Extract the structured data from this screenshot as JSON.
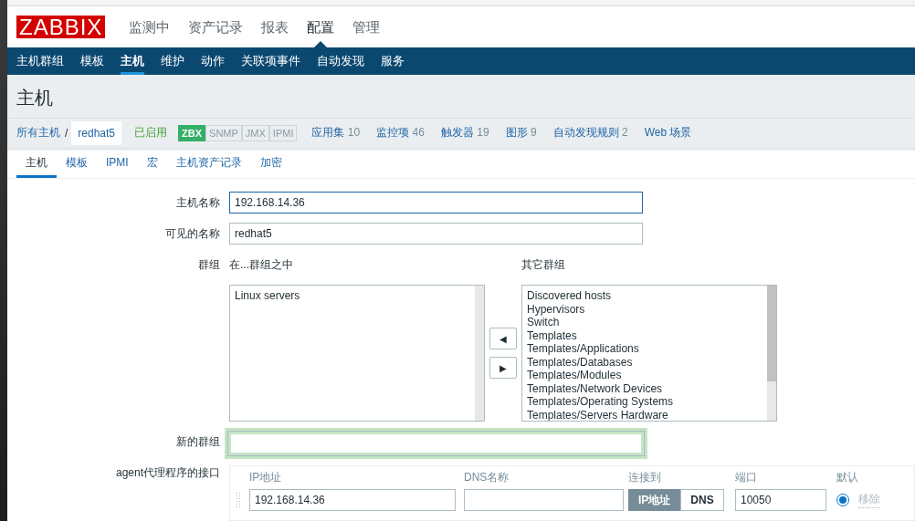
{
  "logo": "ZABBIX",
  "main_menu": [
    {
      "label": "监测中",
      "selected": false
    },
    {
      "label": "资产记录",
      "selected": false
    },
    {
      "label": "报表",
      "selected": false
    },
    {
      "label": "配置",
      "selected": true
    },
    {
      "label": "管理",
      "selected": false
    }
  ],
  "sub_menu": [
    {
      "label": "主机群组",
      "selected": false
    },
    {
      "label": "模板",
      "selected": false
    },
    {
      "label": "主机",
      "selected": true
    },
    {
      "label": "维护",
      "selected": false
    },
    {
      "label": "动作",
      "selected": false
    },
    {
      "label": "关联项事件",
      "selected": false
    },
    {
      "label": "自动发现",
      "selected": false
    },
    {
      "label": "服务",
      "selected": false
    }
  ],
  "page_title": "主机",
  "breadcrumb": {
    "root": "所有主机",
    "separator": "/",
    "current": "redhat5"
  },
  "status": "已启用",
  "availability": [
    {
      "label": "ZBX",
      "on": true
    },
    {
      "label": "SNMP",
      "on": false
    },
    {
      "label": "JMX",
      "on": false
    },
    {
      "label": "IPMI",
      "on": false
    }
  ],
  "host_links": [
    {
      "label": "应用集",
      "count": "10"
    },
    {
      "label": "监控项",
      "count": "46"
    },
    {
      "label": "触发器",
      "count": "19"
    },
    {
      "label": "图形",
      "count": "9"
    },
    {
      "label": "自动发现规则",
      "count": "2"
    },
    {
      "label": "Web 场景"
    }
  ],
  "form_tabs": [
    {
      "label": "主机",
      "selected": true
    },
    {
      "label": "模板",
      "selected": false
    },
    {
      "label": "IPMI",
      "selected": false
    },
    {
      "label": "宏",
      "selected": false
    },
    {
      "label": "主机资产记录",
      "selected": false
    },
    {
      "label": "加密",
      "selected": false
    }
  ],
  "host_name": {
    "label": "主机名称",
    "value": "192.168.14.36"
  },
  "visible_name": {
    "label": "可见的名称",
    "value": "redhat5"
  },
  "groups": {
    "label": "群组",
    "in_title": "在...群组之中",
    "other_title": "其它群组",
    "in_groups": [
      "Linux servers"
    ],
    "other_groups": [
      "Discovered hosts",
      "Hypervisors",
      "Switch",
      "Templates",
      "Templates/Applications",
      "Templates/Databases",
      "Templates/Modules",
      "Templates/Network Devices",
      "Templates/Operating Systems",
      "Templates/Servers Hardware"
    ],
    "move_left": "◀",
    "move_right": "▶"
  },
  "new_group": {
    "label": "新的群组"
  },
  "agent_interfaces": {
    "label": "agent代理程序的接口",
    "columns": [
      "IP地址",
      "DNS名称",
      "连接到",
      "端口",
      "默认"
    ],
    "rows": [
      {
        "ip": "192.168.14.36",
        "connect": [
          {
            "label": "IP地址",
            "selected": true
          },
          {
            "label": "DNS",
            "selected": false
          }
        ],
        "port": "10050",
        "default": true,
        "remove": "移除"
      }
    ]
  }
}
